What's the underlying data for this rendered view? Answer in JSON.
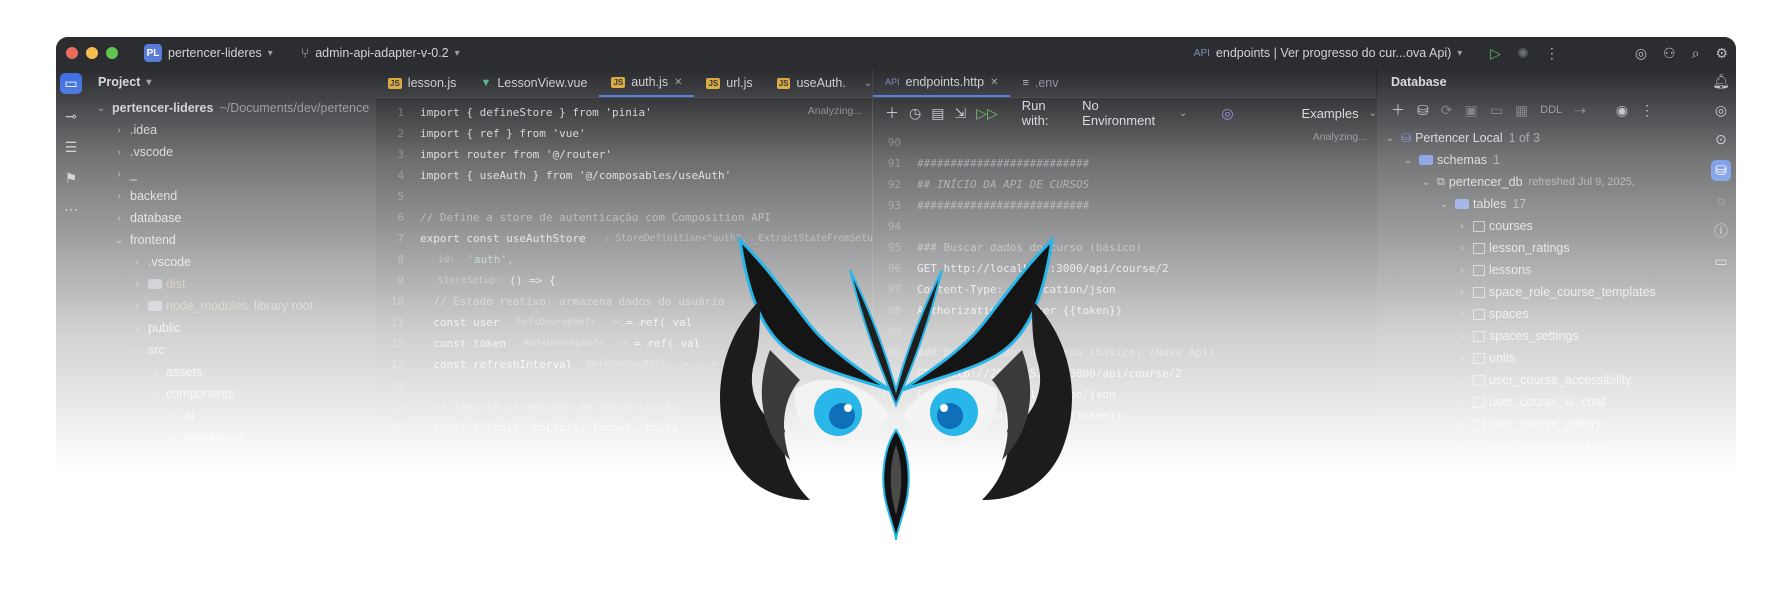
{
  "titlebar": {
    "project_badge": "PL",
    "project_name": "pertencer-lideres",
    "branch": "admin-api-adapter-v-0.2",
    "run_config": "endpoints | Ver progresso do cur...ova Api)"
  },
  "project_panel": {
    "title": "Project",
    "root": "pertencer-lideres",
    "root_path": "~/Documents/dev/pertence",
    "items": [
      {
        "label": ".idea"
      },
      {
        "label": ".vscode"
      },
      {
        "label": "_"
      },
      {
        "label": "backend"
      },
      {
        "label": "database"
      },
      {
        "label": "frontend"
      },
      {
        "label": ".vscode"
      },
      {
        "label": "dist"
      },
      {
        "label": "node_modules",
        "note": "library root"
      },
      {
        "label": "public"
      },
      {
        "label": "src"
      },
      {
        "label": "assets"
      },
      {
        "label": "components"
      },
      {
        "label": "ai"
      },
      {
        "label": "dashboard"
      }
    ]
  },
  "editor_left": {
    "tabs": [
      {
        "label": "lesson.js"
      },
      {
        "label": "LessonView.vue"
      },
      {
        "label": "auth.js"
      },
      {
        "label": "url.js"
      },
      {
        "label": "useAuth."
      }
    ],
    "status": "Analyzing...",
    "lines": [
      {
        "n": "1",
        "t": "import { defineStore } from 'pinia'"
      },
      {
        "n": "2",
        "t": "import { ref } from 'vue'"
      },
      {
        "n": "3",
        "t": "import router from '@/router'"
      },
      {
        "n": "4",
        "t": "import { useAuth } from '@/composables/useAuth'"
      },
      {
        "n": "5",
        "t": ""
      },
      {
        "n": "6",
        "t": "// Define a store de autenticação com Composition API"
      },
      {
        "n": "7",
        "t": "export const useAuthStore"
      },
      {
        "n": "8",
        "t": "  'auth',"
      },
      {
        "n": "9",
        "t": "  () => {"
      },
      {
        "n": "10",
        "t": "  // Estado reativo: armazena dados do usuário"
      },
      {
        "n": "11",
        "t": "  const user"
      },
      {
        "n": "12",
        "t": "  const token"
      },
      {
        "n": "13",
        "t": "  const refreshInterval"
      },
      {
        "n": "14",
        "t": ""
      },
      {
        "n": "15",
        "t": "  // Importa os métodos de autenticação"
      },
      {
        "n": "16",
        "t": "  const { login: doLogin, logout, doLog"
      }
    ],
    "hint_7": ": StoreDefinition<\"auth\", _ExtractStateFromSetupStore<...>, _Extra",
    "hint_8_id": "id:",
    "hint_9_setup": "storeSetup:",
    "hint_11": "Ref<UnwrapRef<...>,...>",
    "hint_11_tail": "= ref( val",
    "hint_12": "Ref<UnwrapRef<...>,...>",
    "hint_12_tail": "= ref( val",
    "hint_13": "Ref<UnwrapRef<...>,...>"
  },
  "editor_right": {
    "tabs": [
      {
        "label": "endpoints.http",
        "badge": "API"
      },
      {
        "label": ".env"
      }
    ],
    "run_with_label": "Run with:",
    "environment": "No Environment",
    "examples": "Examples",
    "status": "Analyzing...",
    "lines": [
      {
        "n": "90",
        "t": ""
      },
      {
        "n": "91",
        "t": "##########################"
      },
      {
        "n": "92",
        "t": "## INÍCIO DA API DE CURSOS"
      },
      {
        "n": "93",
        "t": "##########################"
      },
      {
        "n": "94",
        "t": ""
      },
      {
        "n": "95",
        "t": "### Buscar dados do curso (básico)"
      },
      {
        "n": "96",
        "t": "GET http://localhost:3000/api/course/2"
      },
      {
        "n": "97",
        "t": "Content-Type: application/json"
      },
      {
        "n": "98",
        "t": "Authorization: Bearer {{token}}"
      },
      {
        "n": "99",
        "t": ""
      },
      {
        "n": "100",
        "t": "### Buscar dados do curso (básico) (Nova Api)"
      },
      {
        "n": "101",
        "t": "GET http://203.185.226:3000/api/course/2"
      },
      {
        "n": "102",
        "t": "Content-Type: application/json"
      },
      {
        "n": "103",
        "t": "Authorization: Bearer {{token}}"
      }
    ]
  },
  "database_panel": {
    "title": "Database",
    "ddl": "DDL",
    "connection": "Pertencer Local",
    "connection_count": "1 of 3",
    "schemas": "schemas",
    "schemas_count": "1",
    "db_name": "pertencer_db",
    "db_refreshed": "refreshed Jul 9, 2025,",
    "tables_label": "tables",
    "tables_count": "17",
    "tables": [
      "courses",
      "lesson_ratings",
      "lessons",
      "space_role_course_templates",
      "spaces",
      "spaces_settings",
      "units",
      "user_course_accessibility",
      "user_course_ai_chat",
      "user_course_gallery",
      "user_course_module"
    ]
  },
  "colors": {
    "ide_bg": "#1f2023",
    "panel_bg": "#2b2d30",
    "accent": "#3d74e0",
    "owl_eye": "#29b6e8"
  },
  "icons": [
    "folder-icon",
    "commit-icon",
    "structure-icon",
    "bookmarks-icon",
    "more-icon",
    "run-icon",
    "debug-icon",
    "settings-icon",
    "search-icon",
    "add-user-icon",
    "notifications-icon",
    "database-icon",
    "owl-logo"
  ]
}
